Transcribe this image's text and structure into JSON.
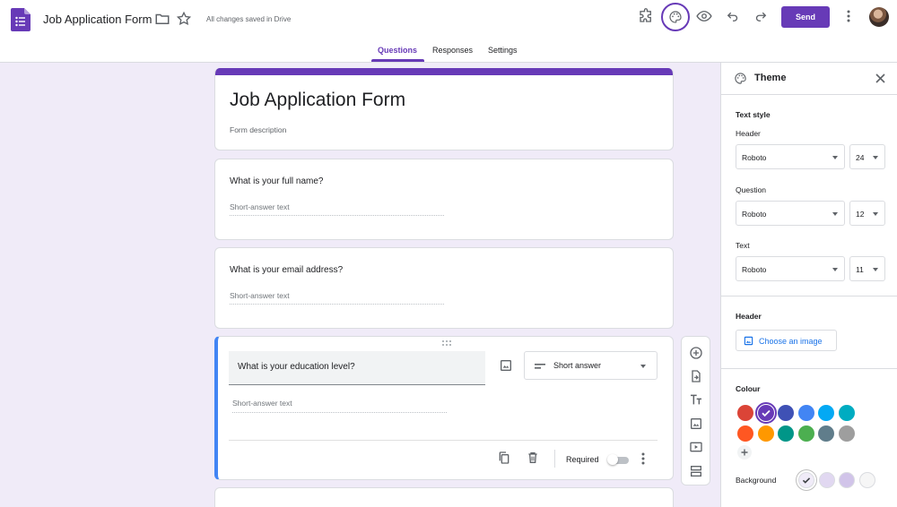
{
  "header": {
    "doc_title": "Job Application Form",
    "saved_status": "All changes saved in Drive",
    "send_label": "Send",
    "icons": [
      "forms-app-icon",
      "folder-icon",
      "star-icon",
      "addon-puzzle-icon",
      "palette-icon",
      "preview-eye-icon",
      "undo-icon",
      "redo-icon",
      "more-vert-icon",
      "avatar"
    ]
  },
  "tabs": [
    {
      "label": "Questions",
      "active": true
    },
    {
      "label": "Responses",
      "active": false
    },
    {
      "label": "Settings",
      "active": false
    }
  ],
  "form": {
    "title": "Job Application Form",
    "description_placeholder": "Form description",
    "questions": [
      {
        "title": "What is your full name?",
        "answer_placeholder": "Short-answer text"
      },
      {
        "title": "What is your email address?",
        "answer_placeholder": "Short-answer text"
      },
      {
        "title": "What is your education level?",
        "answer_placeholder": "Short-answer text",
        "type": "Short answer",
        "required_label": "Required",
        "required": false
      }
    ]
  },
  "theme_panel": {
    "title": "Theme",
    "text_style_heading": "Text style",
    "fields": [
      {
        "label": "Header",
        "font": "Roboto",
        "size": "24"
      },
      {
        "label": "Question",
        "font": "Roboto",
        "size": "12"
      },
      {
        "label": "Text",
        "font": "Roboto",
        "size": "11"
      }
    ],
    "header_heading": "Header",
    "choose_image_label": "Choose an image",
    "colour_heading": "Colour",
    "colours": [
      "#db4437",
      "#673ab7",
      "#3f51b5",
      "#4285f4",
      "#03a9f4",
      "#00acc1",
      "#ff5722",
      "#ff9800",
      "#009688",
      "#4caf50",
      "#607d8b",
      "#9e9e9e"
    ],
    "selected_colour": "#673ab7",
    "background_label": "Background",
    "backgrounds": [
      "#f0ebf8",
      "#e1d8f1",
      "#d1c4e9",
      "#f6f6f6"
    ],
    "selected_background": "#f0ebf8"
  }
}
